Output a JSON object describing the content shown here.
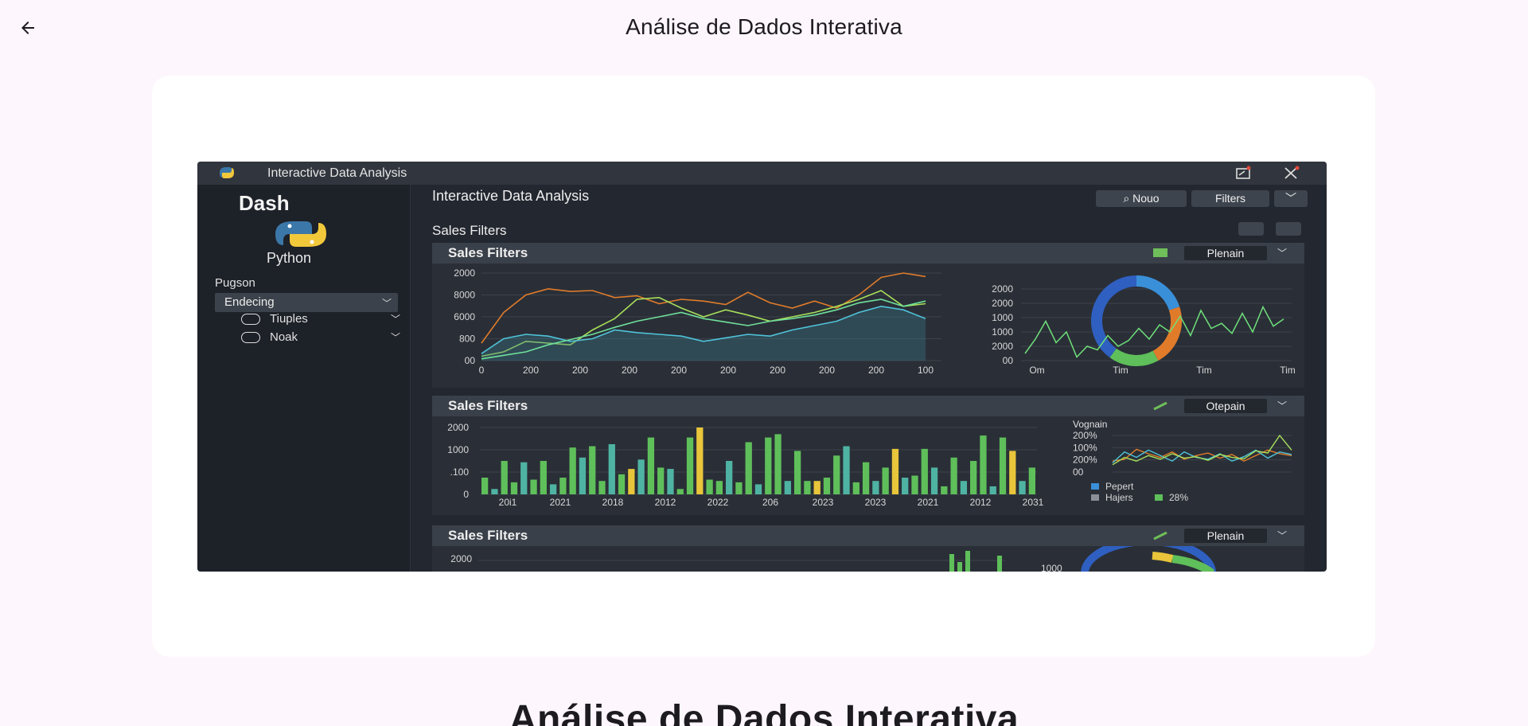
{
  "appbar": {
    "title": "Análise de Dados Interativa",
    "back_icon": "arrow-back-icon"
  },
  "page": {
    "heading": "Análise de Dados Interativa"
  },
  "colors": {
    "background": "#fdf6fc",
    "card": "#ffffff",
    "text": "#1d1b20"
  },
  "screenshot": {
    "window_title": "Interactive Data Analysis",
    "sidebar": {
      "brand": "Dash",
      "logo_label": "Python",
      "section_label": "Pugson",
      "select_value": "Endecing",
      "items": [
        {
          "label": "Tiuples",
          "icon": "circle-icon"
        },
        {
          "label": "Noak",
          "icon": "circle-icon"
        }
      ]
    },
    "main": {
      "title": "Interactive Data Analysis",
      "buttons": {
        "search": "Nouo",
        "filters": "Filters"
      },
      "section_label": "Sales Filters",
      "panels": [
        {
          "title": "Sales Filters",
          "dropdown": "Plenain"
        },
        {
          "title": "Sales Filters",
          "dropdown": "Otepain"
        },
        {
          "title": "Sales Filters",
          "dropdown": "Plenain"
        }
      ]
    }
  },
  "chart_data": [
    {
      "type": "line",
      "ytick_labels": [
        "2000",
        "8000",
        "6000",
        "800",
        "00"
      ],
      "xtick_labels": [
        "0",
        "200",
        "200",
        "200",
        "200",
        "200",
        "200",
        "200",
        "200",
        "100"
      ],
      "series": [
        {
          "color": "#e07b2a",
          "values": [
            20,
            55,
            75,
            82,
            79,
            80,
            72,
            74,
            65,
            70,
            68,
            64,
            78,
            66,
            60,
            68,
            60,
            75,
            95,
            100,
            96
          ]
        },
        {
          "color": "#a8e05a",
          "values": [
            5,
            10,
            22,
            20,
            18,
            35,
            48,
            70,
            72,
            60,
            50,
            58,
            52,
            45,
            50,
            55,
            62,
            70,
            80,
            62,
            65
          ]
        },
        {
          "color": "#4fc3d9",
          "values": [
            8,
            25,
            30,
            28,
            22,
            25,
            35,
            32,
            30,
            28,
            22,
            26,
            30,
            28,
            35,
            40,
            45,
            55,
            62,
            58,
            48
          ]
        },
        {
          "color": "#6fe09a",
          "values": [
            2,
            6,
            10,
            18,
            24,
            30,
            38,
            45,
            50,
            55,
            48,
            44,
            40,
            45,
            48,
            52,
            58,
            66,
            70,
            62,
            68
          ]
        }
      ]
    },
    {
      "type": "pie",
      "ytick_labels": [
        "2000",
        "2000",
        "1000",
        "1000",
        "2000",
        "00"
      ],
      "xtick_labels": [
        "Om",
        "Tim",
        "Tim",
        "Tim"
      ],
      "slices": [
        {
          "color": "#3a8fd9",
          "value": 20
        },
        {
          "color": "#e07b2a",
          "value": 22
        },
        {
          "color": "#5fbf5a",
          "value": 18
        },
        {
          "color": "#2f5fc0",
          "value": 40
        }
      ]
    },
    {
      "type": "bar",
      "ytick_labels": [
        "2000",
        "1000",
        ".100",
        "0"
      ],
      "xtick_labels": [
        "20i1",
        "2021",
        "2018",
        "2012",
        "2022",
        "206",
        "2023",
        "2023",
        "2021",
        "2012",
        "2031"
      ],
      "values": [
        25,
        8,
        50,
        18,
        48,
        22,
        50,
        15,
        25,
        70,
        55,
        72,
        20,
        75,
        30,
        38,
        52,
        85,
        40,
        38,
        8,
        85,
        100,
        22,
        20,
        50,
        18,
        78,
        15,
        85,
        90,
        20,
        65,
        20,
        20,
        25,
        58,
        72,
        18,
        48,
        20,
        40,
        68,
        25,
        28,
        68,
        40,
        12,
        55,
        20,
        50,
        88,
        12,
        85,
        65,
        20,
        40
      ],
      "highlight_indices": [
        15,
        22,
        34,
        42,
        54
      ],
      "colors": {
        "bar": "#5fbf5a",
        "alt": "#4fb3a3",
        "highlight": "#e8c53a"
      }
    },
    {
      "type": "line",
      "legend": [
        "Pepert",
        "Hajers",
        "28%"
      ],
      "title": "Vognain",
      "ytick_labels": [
        "200%",
        "100%",
        "200%",
        "00"
      ],
      "series": [
        {
          "color": "#e07b2a",
          "values": [
            30,
            35,
            62,
            50,
            40,
            55,
            35,
            45,
            52,
            38,
            48,
            30,
            45,
            60,
            50,
            45
          ]
        },
        {
          "color": "#4fc3d9",
          "values": [
            25,
            55,
            40,
            60,
            45,
            30,
            55,
            40,
            35,
            50,
            30,
            42,
            60,
            38,
            55,
            48
          ]
        },
        {
          "color": "#a8e05a",
          "values": [
            20,
            40,
            30,
            45,
            35,
            50,
            38,
            42,
            32,
            48,
            40,
            36,
            58,
            52,
            100,
            60
          ]
        }
      ]
    }
  ]
}
